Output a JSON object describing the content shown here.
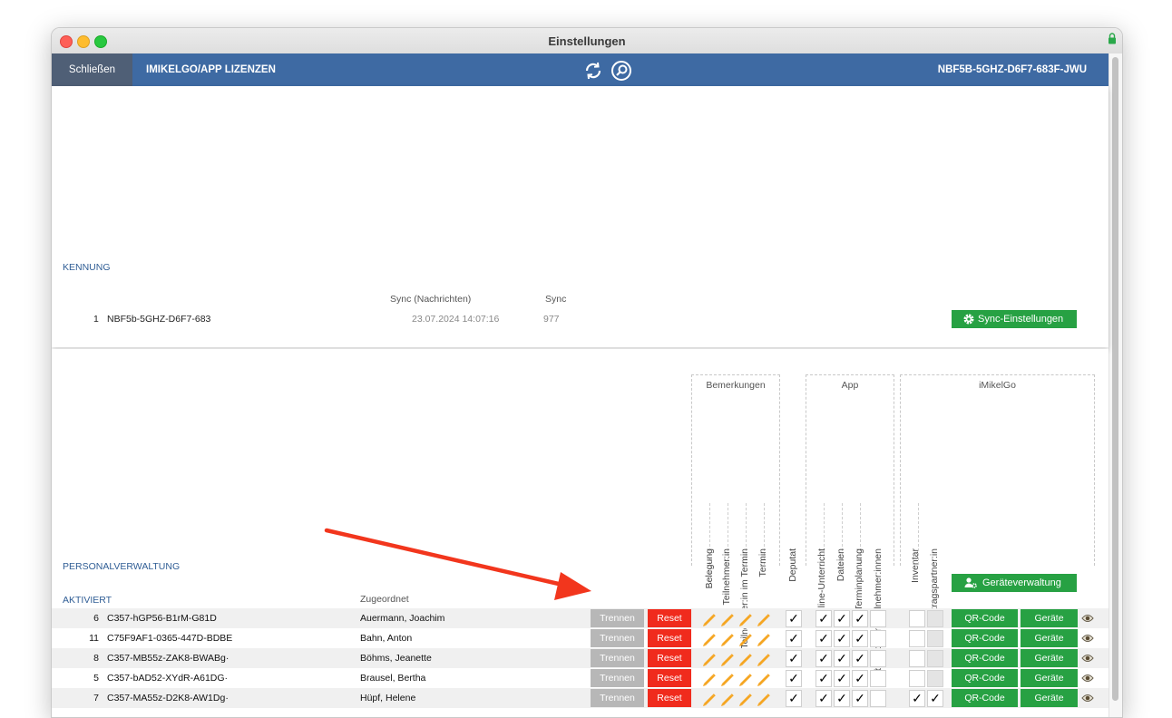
{
  "window": {
    "title": "Einstellungen"
  },
  "toolbar": {
    "close_label": "Schließen",
    "section_label": "IMIKELGO/APP LIZENZEN",
    "license_id": "NBF5B-5GHZ-D6F7-683F-JWU"
  },
  "kennung": {
    "heading": "KENNUNG",
    "col_sync_msgs": "Sync (Nachrichten)",
    "col_sync": "Sync",
    "row": {
      "nr": "1",
      "id": "NBF5b-5GHZ-D6F7-683",
      "sync_date": "23.07.2024 14:07:16",
      "sync_count": "977"
    },
    "sync_settings_label": "Sync-Einstellungen"
  },
  "personal": {
    "heading": "PERSONALVERWALTUNG",
    "activated_label": "AKTIVIERT",
    "assigned_label": "Zugeordnet",
    "group_bemerkungen": "Bemerkungen",
    "group_app": "App",
    "group_imikelgo": "iMikelGo",
    "columns": [
      "Belegung",
      "Teilnehmer:in",
      "Teilnehmer:in im Termin",
      "Termin",
      "Deputat",
      "Online-Unterricht",
      "Dateien",
      "Terminplanung",
      "Geburtsdatum Teilnehmer:innen",
      "Inventar",
      "Vertragspartner:in"
    ],
    "device_mgmt_label": "Geräteverwaltung",
    "trennen_label": "Trennen",
    "reset_label": "Reset",
    "qr_label": "QR-Code",
    "geraete_label": "Geräte",
    "check_mark": "✓",
    "rows": [
      {
        "nr": "6",
        "id": "C357-hGP56-B1rM-G81D",
        "name": "Auermann, Joachim",
        "inventar": "",
        "vertrag": ""
      },
      {
        "nr": "11",
        "id": "C75F9AF1-0365-447D-BDBE",
        "name": "Bahn, Anton",
        "inventar": "",
        "vertrag": ""
      },
      {
        "nr": "8",
        "id": "C357-MB55z-ZAK8-BWABg·",
        "name": "Böhms, Jeanette",
        "inventar": "",
        "vertrag": ""
      },
      {
        "nr": "5",
        "id": "C357-bAD52-XYdR-A61DG·",
        "name": "Brausel, Bertha",
        "inventar": "",
        "vertrag": ""
      },
      {
        "nr": "7",
        "id": "C357-MA55z-D2K8-AW1Dg·",
        "name": "Hüpf, Helene",
        "inventar": "✓",
        "vertrag": "✓"
      }
    ]
  },
  "colors": {
    "toolbar": "#3e6aa3",
    "green": "#27a143",
    "red": "#f02b1d",
    "pencil": "#f5a623",
    "arrow": "#f2361d"
  }
}
